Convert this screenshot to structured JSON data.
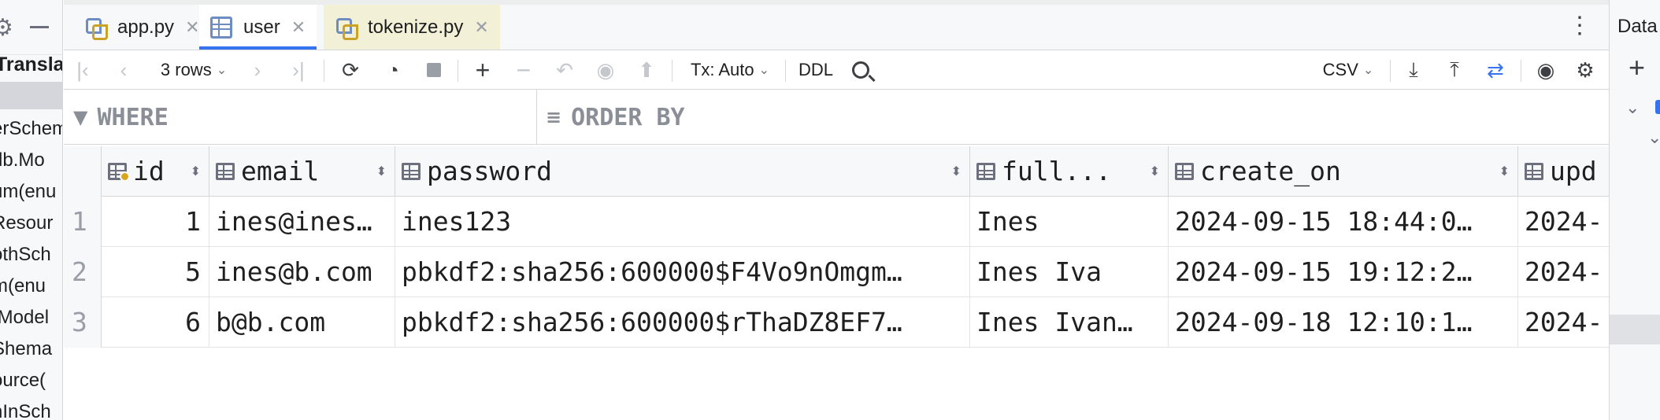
{
  "left_panel": {
    "title": "Transla",
    "items": [
      "erSchem",
      "db.Mo",
      "um(enu",
      "Resour",
      "othSch",
      "m(enu",
      ".Model",
      "Shema",
      "ource(",
      "nInSch"
    ]
  },
  "right_panel": {
    "title": "Data"
  },
  "tabs": [
    {
      "label": "app.py",
      "icon": "python-file-icon",
      "active": false
    },
    {
      "label": "user",
      "icon": "table-icon",
      "active": true
    },
    {
      "label": "tokenize.py",
      "icon": "python-file-icon",
      "active": false
    }
  ],
  "toolbar": {
    "rows_label": "3 rows",
    "tx_label": "Tx: Auto",
    "ddl_label": "DDL",
    "export_format": "CSV"
  },
  "filters": {
    "where_label": "WHERE",
    "order_by_label": "ORDER BY"
  },
  "grid": {
    "columns": [
      "id",
      "email",
      "password",
      "full...",
      "create_on",
      "upd"
    ],
    "rows": [
      {
        "num": "1",
        "id": "1",
        "email": "ines@ines…",
        "password": "ines123",
        "full": "Ines",
        "create_on": "2024-09-15 18:44:0…",
        "upd": "2024-"
      },
      {
        "num": "2",
        "id": "5",
        "email": "ines@b.com",
        "password": "pbkdf2:sha256:600000$F4Vo9nOmgm…",
        "full": "Ines Iva",
        "create_on": "2024-09-15 19:12:2…",
        "upd": "2024-"
      },
      {
        "num": "3",
        "id": "6",
        "email": "b@b.com",
        "password": "pbkdf2:sha256:600000$rThaDZ8EF7…",
        "full": "Ines Ivan…",
        "create_on": "2024-09-18 12:10:1…",
        "upd": "2024-"
      }
    ]
  },
  "colors": {
    "accent": "#3574f0",
    "key_icon": "#d9a520",
    "panel_bg": "#f7f8fa"
  }
}
